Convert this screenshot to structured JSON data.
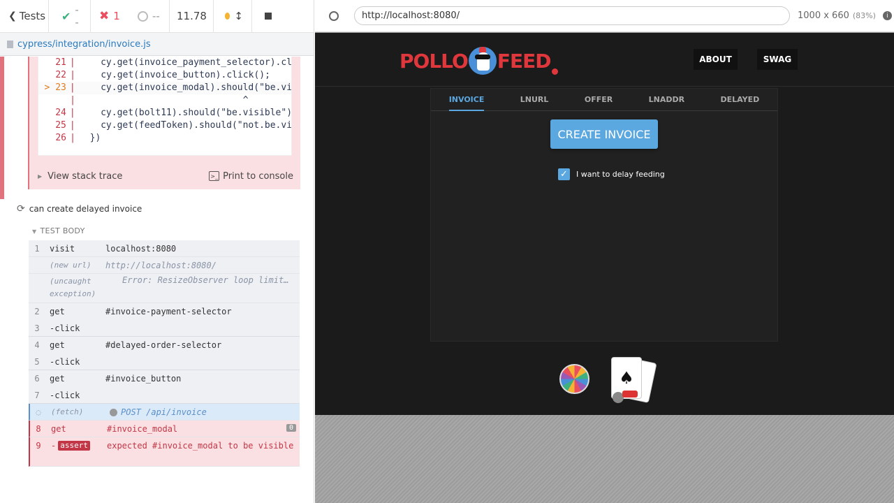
{
  "reporter": {
    "tests_label": "Tests",
    "passed": "--",
    "failed": "1",
    "pending": "--",
    "duration": "11.78",
    "file": "cypress/integration/invoice.js"
  },
  "code": [
    {
      "n": "21",
      "b": "|",
      "c": "    cy.get(invoice_payment_selector).cl"
    },
    {
      "n": "22",
      "b": "|",
      "c": "    cy.get(invoice_button).click();"
    },
    {
      "n": "> 23",
      "b": "|",
      "c": "    cy.get(invoice_modal).should(\"be.vi"
    },
    {
      "n": "",
      "b": "|",
      "c": "                              ^"
    },
    {
      "n": "24",
      "b": "|",
      "c": "    cy.get(bolt11).should(\"be.visible\")"
    },
    {
      "n": "25",
      "b": "|",
      "c": "    cy.get(feedToken).should(\"not.be.vi"
    },
    {
      "n": "26",
      "b": "|",
      "c": "  })"
    }
  ],
  "stack": {
    "view": "View stack trace",
    "print": "Print to console"
  },
  "test": {
    "title": "can create delayed invoice",
    "body_label": "TEST BODY"
  },
  "commands": [
    {
      "n": "1",
      "name": "visit",
      "msg": "localhost:8080",
      "kind": "cmd"
    },
    {
      "n": "",
      "name": "(new url)",
      "msg": "http://localhost:8080/",
      "kind": "event"
    },
    {
      "n": "",
      "name": "(uncaught exception)",
      "msg": "   Error: ResizeObserver loop limit…",
      "kind": "event"
    },
    {
      "n": "2",
      "name": "get",
      "msg": "#invoice-payment-selector",
      "kind": "cmd"
    },
    {
      "n": "3",
      "name": " -click",
      "msg": "",
      "kind": "cmd"
    },
    {
      "n": "4",
      "name": "get",
      "msg": "#delayed-order-selector",
      "kind": "cmd"
    },
    {
      "n": "5",
      "name": " -click",
      "msg": "",
      "kind": "cmd"
    },
    {
      "n": "6",
      "name": "get",
      "msg": "#invoice_button",
      "kind": "cmd"
    },
    {
      "n": "7",
      "name": " -click",
      "msg": "",
      "kind": "cmd"
    },
    {
      "n": "",
      "name": "(fetch)",
      "msg": "POST /api/invoice",
      "kind": "fetch"
    },
    {
      "n": "8",
      "name": "get",
      "msg": "#invoice_modal",
      "kind": "err",
      "badge": "0"
    },
    {
      "n": "9",
      "name": "assert",
      "msg": "expected #invoice_modal to be visible",
      "kind": "err"
    }
  ],
  "browser": {
    "url": "http://localhost:8080/",
    "viewport": "1000 x 660",
    "scale": "(83%)"
  },
  "app": {
    "logo1": "POLLO",
    "logo2": "FEED",
    "nav": [
      "ABOUT",
      "SWAG"
    ],
    "tabs": [
      "INVOICE",
      "LNURL",
      "OFFER",
      "LNADDR",
      "DELAYED"
    ],
    "create_label": "CREATE INVOICE",
    "delay_label": "I want to delay feeding"
  }
}
